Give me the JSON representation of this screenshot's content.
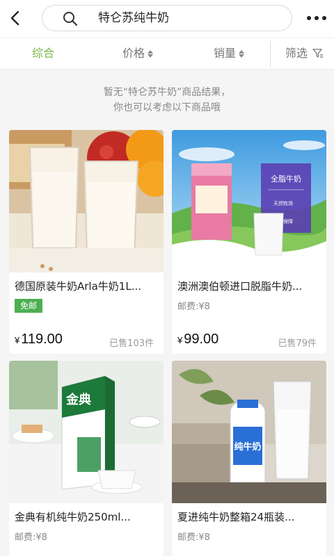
{
  "header": {
    "back_icon": "chevron-left-icon",
    "search_query": "特仑苏纯牛奶",
    "search_icon": "search-icon",
    "more_icon": "more-horizontal-icon"
  },
  "filter_tabs": [
    {
      "label": "综合"
    },
    {
      "label": "价格"
    },
    {
      "label": "销量"
    },
    {
      "label": "筛选"
    }
  ],
  "notice": {
    "line1": "暂无“特仑苏牛奶”商品结果，",
    "line2": "你也可以考虑以下商品哦"
  },
  "products": [
    {
      "title": "德国原装牛奶Arla牛奶1L...",
      "badge": "免邮",
      "currency": "¥",
      "price": "119.00",
      "sold": "已售103件"
    },
    {
      "title": "澳洲澳伯顿进口脱脂牛奶...",
      "shipping": "邮费:¥8",
      "currency": "¥",
      "price": "99.00",
      "sold": "已售79件",
      "pack_label": "全脂牛奶",
      "pack_feature1": "天然牧场",
      "pack_feature2": "品质保障"
    },
    {
      "title": "金典有机纯牛奶250ml...",
      "shipping": "邮费:¥8",
      "brand_text": "金典"
    },
    {
      "title": "夏进纯牛奶整箱24瓶装...",
      "shipping": "邮费:¥8",
      "bottle_label": "纯牛奶"
    }
  ],
  "colors": {
    "accent": "#7ab648",
    "badge": "#4caf50"
  }
}
